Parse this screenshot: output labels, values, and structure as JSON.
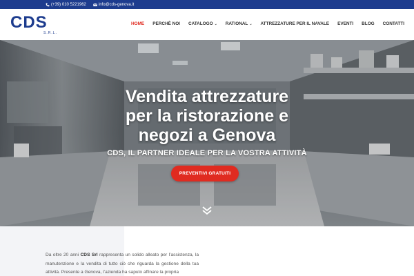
{
  "topbar": {
    "phone": "(+39) 010 5221962",
    "email": "info@cds-genova.it"
  },
  "logo": {
    "text": "CDS",
    "sub": "S.R.L."
  },
  "nav": {
    "items": [
      {
        "label": "HOME",
        "active": true,
        "dropdown": false
      },
      {
        "label": "PERCHÈ NOI",
        "active": false,
        "dropdown": false
      },
      {
        "label": "CATALOGO",
        "active": false,
        "dropdown": true
      },
      {
        "label": "RATIONAL",
        "active": false,
        "dropdown": true
      },
      {
        "label": "ATTREZZATURE PER IL NAVALE",
        "active": false,
        "dropdown": false
      },
      {
        "label": "EVENTI",
        "active": false,
        "dropdown": false
      },
      {
        "label": "BLOG",
        "active": false,
        "dropdown": false
      },
      {
        "label": "CONTATTI",
        "active": false,
        "dropdown": false
      }
    ]
  },
  "hero": {
    "title_line1": "Vendita attrezzature",
    "title_line2": "per la ristorazione e",
    "title_line3": "negozi a Genova",
    "subtitle": "CDS, IL PARTNER IDEALE PER LA VOSTRA ATTIVITÀ",
    "cta": "PREVENTIVI GRATUITI"
  },
  "intro": {
    "before": "Da oltre 20 anni ",
    "company": "CDS Srl",
    "after": " rappresenta un solido alleato per l’assistenza, la manutenzione e la vendita di tutto ciò che riguarda la gestione della tua attività. Presente a Genova, l’azienda ha saputo affinare la propria"
  },
  "colors": {
    "brand_blue": "#1d3c8e",
    "accent_red": "#e02b20"
  },
  "icons": {
    "phone": "phone-icon",
    "email": "envelope-icon",
    "scroll": "chevron-double-down-icon"
  }
}
